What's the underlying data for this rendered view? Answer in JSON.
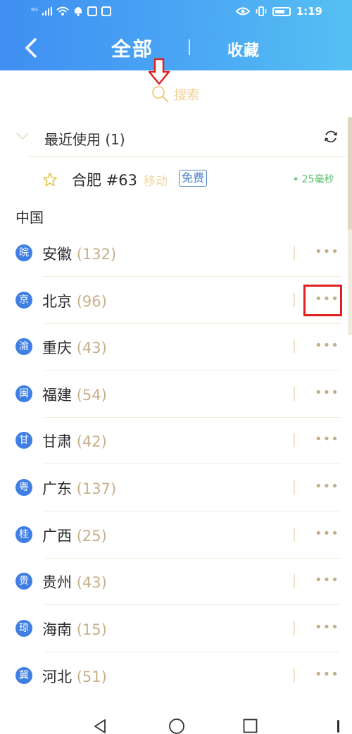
{
  "status_bar": {
    "signal": "⁵ᴳ",
    "time": "1:19"
  },
  "header": {
    "tab_all": "全部",
    "tab_favorites": "收藏"
  },
  "search": {
    "placeholder": "搜索"
  },
  "recent": {
    "title": "最近使用 (1)",
    "item": {
      "name": "合肥 #63",
      "carrier": "移动",
      "badge": "免费",
      "latency": "• 25毫秒"
    }
  },
  "country": "中国",
  "regions": [
    {
      "badge": "皖",
      "name": "安徽",
      "count": "(132)"
    },
    {
      "badge": "京",
      "name": "北京",
      "count": "(96)"
    },
    {
      "badge": "渝",
      "name": "重庆",
      "count": "(43)"
    },
    {
      "badge": "闽",
      "name": "福建",
      "count": "(54)"
    },
    {
      "badge": "甘",
      "name": "甘肃",
      "count": "(42)"
    },
    {
      "badge": "粤",
      "name": "广东",
      "count": "(137)"
    },
    {
      "badge": "桂",
      "name": "广西",
      "count": "(25)"
    },
    {
      "badge": "贵",
      "name": "贵州",
      "count": "(43)"
    },
    {
      "badge": "琼",
      "name": "海南",
      "count": "(15)"
    },
    {
      "badge": "冀",
      "name": "河北",
      "count": "(51)"
    }
  ],
  "more_label": "•••",
  "colors": {
    "header_start": "#3f8ff2",
    "header_end": "#56c0f2",
    "badge": "#3f7fe4",
    "accent_gold": "#c7b08a",
    "latency": "#57bf6a",
    "highlight": "#e02020"
  }
}
